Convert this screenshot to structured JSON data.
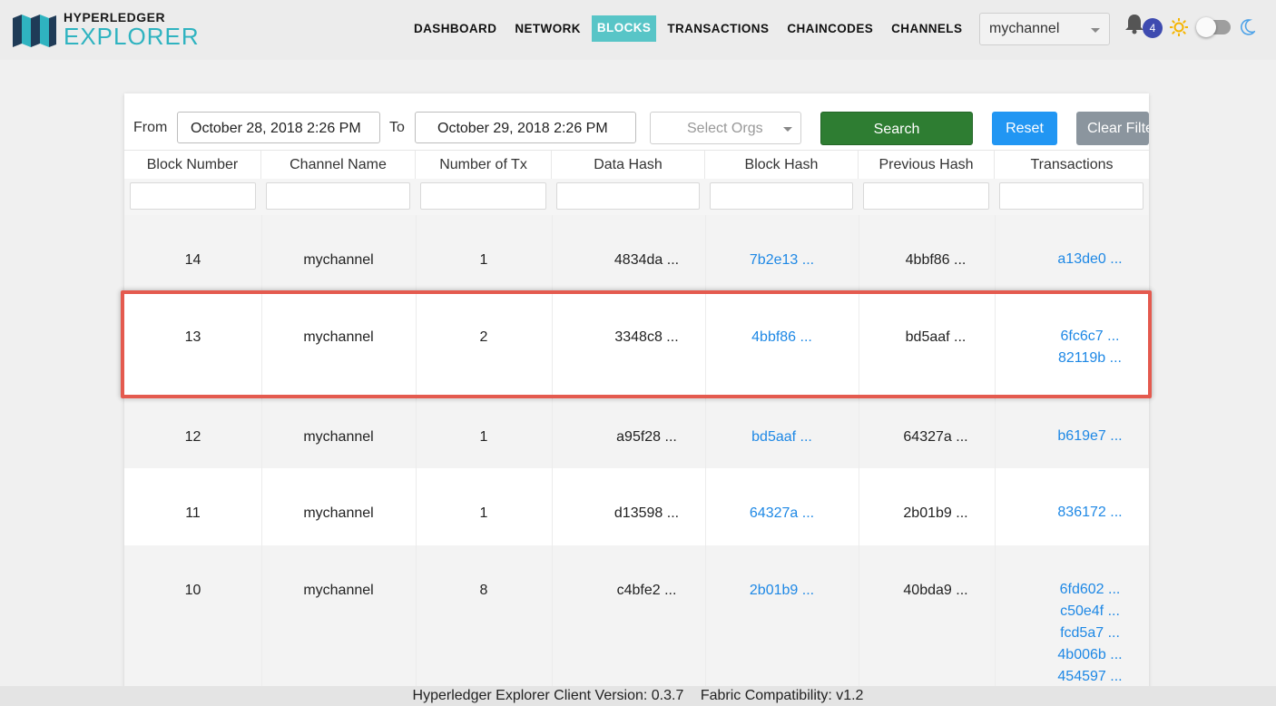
{
  "brand": {
    "top": "HYPERLEDGER",
    "bottom": "EXPLORER"
  },
  "nav": [
    {
      "label": "DASHBOARD",
      "active": false
    },
    {
      "label": "NETWORK",
      "active": false
    },
    {
      "label": "BLOCKS",
      "active": true
    },
    {
      "label": "TRANSACTIONS",
      "active": false
    },
    {
      "label": "CHAINCODES",
      "active": false
    },
    {
      "label": "CHANNELS",
      "active": false
    }
  ],
  "channel_select": {
    "value": "mychannel"
  },
  "notifications": {
    "count": "4"
  },
  "filters": {
    "from_label": "From",
    "from_value": "October 28, 2018 2:26 PM",
    "to_label": "To",
    "to_value": "October 29, 2018 2:26 PM",
    "orgs_placeholder": "Select Orgs",
    "search_label": "Search",
    "reset_label": "Reset",
    "clear_label": "Clear Filter"
  },
  "table": {
    "columns": [
      "Block Number",
      "Channel Name",
      "Number of Tx",
      "Data Hash",
      "Block Hash",
      "Previous Hash",
      "Transactions"
    ],
    "rows": [
      {
        "block_number": "14",
        "channel": "mychannel",
        "num_tx": "1",
        "data_hash": "4834da ...",
        "block_hash": "7b2e13 ...",
        "prev_hash": "4bbf86 ...",
        "transactions": [
          "a13de0 ..."
        ]
      },
      {
        "block_number": "13",
        "channel": "mychannel",
        "num_tx": "2",
        "data_hash": "3348c8 ...",
        "block_hash": "4bbf86 ...",
        "prev_hash": "bd5aaf ...",
        "transactions": [
          "6fc6c7 ...",
          "82119b ..."
        ]
      },
      {
        "block_number": "12",
        "channel": "mychannel",
        "num_tx": "1",
        "data_hash": "a95f28 ...",
        "block_hash": "bd5aaf ...",
        "prev_hash": "64327a ...",
        "transactions": [
          "b619e7 ..."
        ]
      },
      {
        "block_number": "11",
        "channel": "mychannel",
        "num_tx": "1",
        "data_hash": "d13598 ...",
        "block_hash": "64327a ...",
        "prev_hash": "2b01b9 ...",
        "transactions": [
          "836172 ..."
        ]
      },
      {
        "block_number": "10",
        "channel": "mychannel",
        "num_tx": "8",
        "data_hash": "c4bfe2 ...",
        "block_hash": "2b01b9 ...",
        "prev_hash": "40bda9 ...",
        "transactions": [
          "6fd602 ...",
          "c50e4f ...",
          "fcd5a7 ...",
          "4b006b ...",
          "454597 ..."
        ]
      }
    ]
  },
  "footer": {
    "client_version": "Hyperledger Explorer Client Version: 0.3.7",
    "fabric_compat": "Fabric Compatibility: v1.2"
  },
  "colors": {
    "accent": "#58c5c7",
    "link": "#1e88e5",
    "search_button": "#2e7d32",
    "reset_button": "#2196f3",
    "highlight": "#e45a4f"
  }
}
